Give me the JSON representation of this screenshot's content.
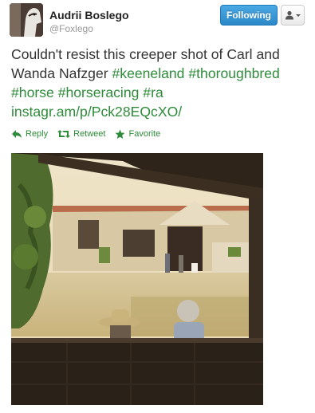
{
  "user": {
    "name": "Audrii Boslego",
    "handle": "@Foxlego"
  },
  "header": {
    "follow_label": "Following",
    "user_menu_icon": "user-dropdown-icon"
  },
  "tweet": {
    "text_plain": "Couldn't resist this creeper shot of Carl and Wanda Nafzger",
    "hashtags": [
      "#keeneland",
      "#thoroughbred",
      "#horse",
      "#horseracing",
      "#ra"
    ],
    "link": "instagr.am/p/Pck28EQcXO/"
  },
  "actions": {
    "reply": "Reply",
    "retweet": "Retweet",
    "favorite": "Favorite"
  },
  "colors": {
    "link": "#2e8b3a",
    "follow_button": "#2b88c8",
    "name": "#222222",
    "handle": "#999999"
  }
}
